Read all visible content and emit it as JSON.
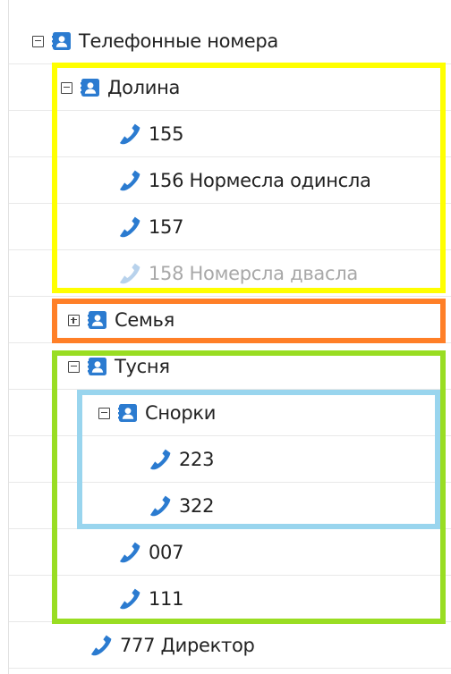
{
  "tree": {
    "root": {
      "label": "Телефонные номера",
      "expanded": true
    },
    "group_dolina": {
      "label": "Долина",
      "expanded": true,
      "phones": [
        "155",
        "156 Нормесла одинсла",
        "157",
        "158 Номерсла двасла"
      ]
    },
    "group_semya": {
      "label": "Семья",
      "expanded": false
    },
    "group_tusnya": {
      "label": "Тусня",
      "expanded": true,
      "subgroup_snorki": {
        "label": "Снорки",
        "expanded": true,
        "phones": [
          "223",
          "322"
        ]
      },
      "phones": [
        "007",
        "111"
      ]
    },
    "root_phones": [
      "777 Директор"
    ]
  },
  "colors": {
    "icon_blue": "#2b7bd0",
    "phone_disabled": "#b8d2ec",
    "highlight_yellow": "#ffff00",
    "highlight_orange": "#ff7f27",
    "highlight_green": "#99dd22",
    "highlight_blue": "#99d5ee"
  },
  "icons": {
    "toggle_expanded": "minus-square-icon",
    "toggle_collapsed": "plus-square-icon",
    "group": "contact-book-icon",
    "phone": "phone-icon"
  }
}
